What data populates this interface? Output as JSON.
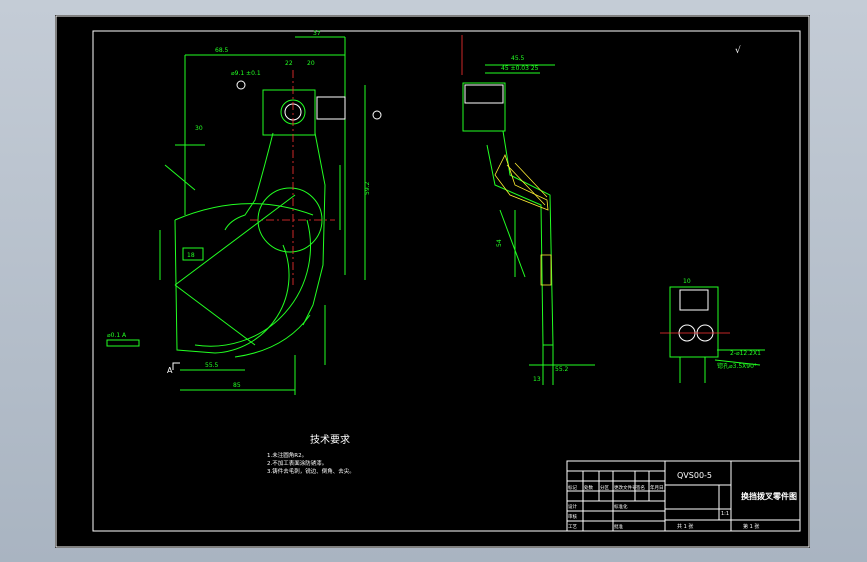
{
  "drawing": {
    "tech_requirements": {
      "title": "技术要求",
      "notes": [
        "1.未注圆角R2。",
        "2.不加工表面涂防锈漆。",
        "3.铸件去毛刺，锐边、倒角、去尖。"
      ]
    },
    "roughness_symbol": "√",
    "section_label_a": "A",
    "tolerance_box": "⌀0.1 A",
    "dimensions": {
      "top_span": "37",
      "width_left": "68.5",
      "width_right": "45.5",
      "sub_right": "45 ±0.03  25",
      "phi_top": "⌀9.1 ±0.1",
      "dim_30": "30",
      "dim_22": "22",
      "dim_20": "20",
      "dim_18": "18",
      "dim_54": "54",
      "bottom_a": "55.5",
      "bottom_b": "85",
      "side_right": "59.2",
      "hole_note": "2-⌀12.2X1",
      "chamfer_note": "锪孔⌀3.5X90°",
      "dim_10": "10",
      "dim_55_2": "55.2",
      "dim_13": "13"
    }
  },
  "title_block": {
    "drawing_number": "QVS00-5",
    "drawing_title": "换挡拨叉零件图",
    "scale": "1:1",
    "header_cells": [
      "标记",
      "处数",
      "分区",
      "更改文件号",
      "签名",
      "年月日"
    ],
    "row_labels": [
      "设计",
      "审核",
      "工艺"
    ],
    "std_label": "标准化",
    "approve_label": "批准",
    "sheet_total": "共  1  张",
    "sheet_index": "第  1  张"
  },
  "colors": {
    "background": "#000000",
    "outline": "#22ff22",
    "text": "#ffffff",
    "centerline": "#ff3333",
    "hatch": "#ffee33"
  }
}
